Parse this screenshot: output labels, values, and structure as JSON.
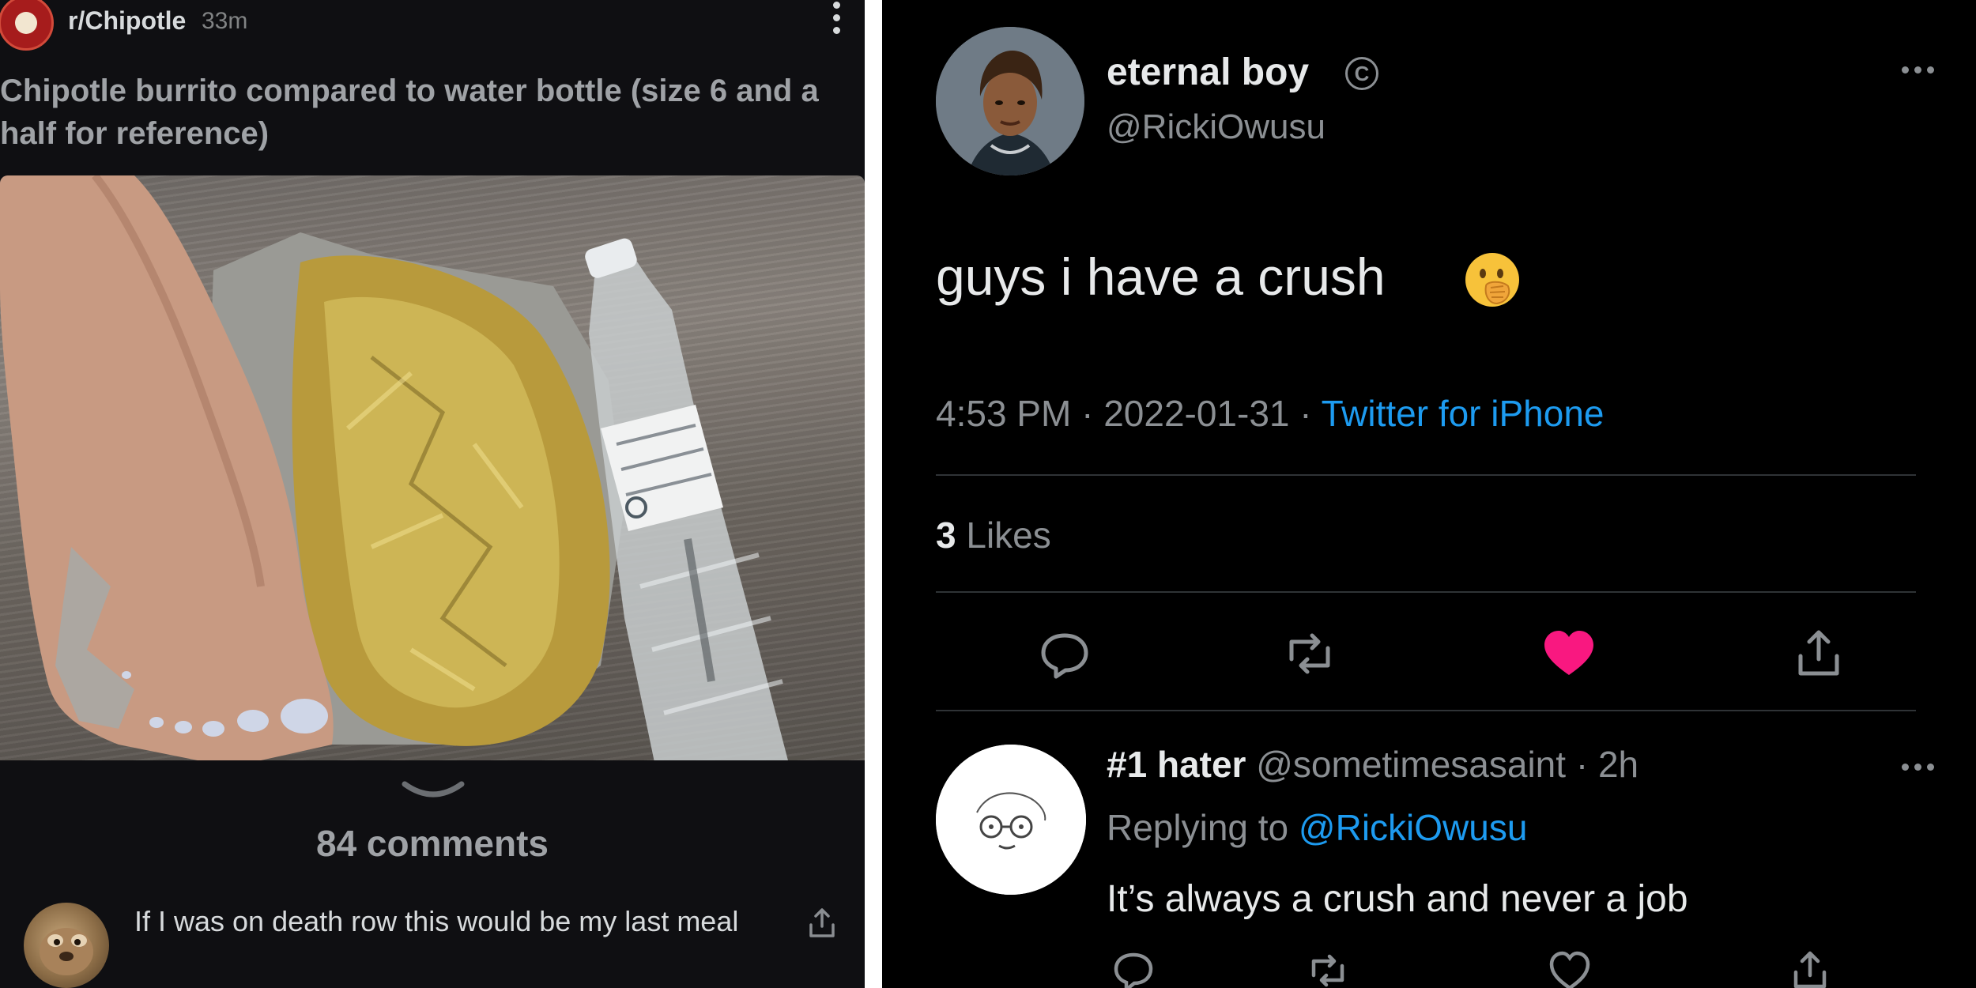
{
  "reddit": {
    "subreddit": "r/Chipotle",
    "age": "33m",
    "title": "Chipotle burrito compared to water bottle (size 6 and a half for reference)",
    "comments_count": "84 comments",
    "top_comment": "If I was on death row this would be my last meal"
  },
  "tweet": {
    "display_name": "eternal boy",
    "handle": "@RickiOwusu",
    "text": "guys i have a crush",
    "time": "4:53 PM",
    "date": "2022-01-31",
    "source": "Twitter for iPhone",
    "likes_count": "3",
    "likes_label": "Likes",
    "liked": true
  },
  "reply": {
    "display_name": "#1 hater",
    "handle": "@sometimesasaint",
    "age": "2h",
    "replying_prefix": "Replying to",
    "replying_to": "@RickiOwusu",
    "text": "It’s always a crush and never a job"
  },
  "colors": {
    "reddit_bg": "#0f0f12",
    "twitter_bg": "#000000",
    "twitter_link": "#1d9bf0",
    "like_pink": "#f91880"
  }
}
